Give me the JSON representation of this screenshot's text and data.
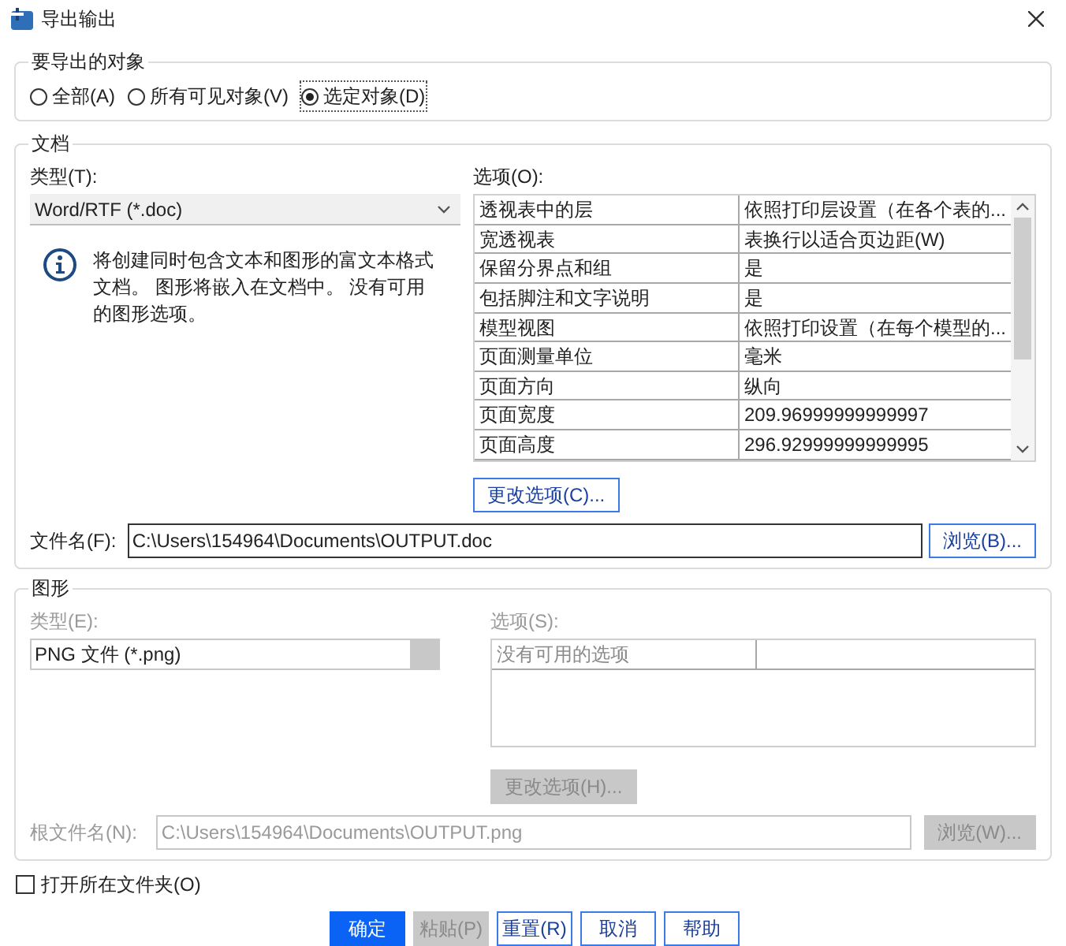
{
  "window": {
    "title": "导出输出"
  },
  "export_objects": {
    "title": "要导出的对象",
    "options": [
      {
        "label": "全部(A)",
        "selected": false
      },
      {
        "label": "所有可见对象(V)",
        "selected": false
      },
      {
        "label": "选定对象(D)",
        "selected": true
      }
    ]
  },
  "document": {
    "title": "文档",
    "type_label": "类型(T):",
    "type_value": "Word/RTF (*.doc)",
    "info": "将创建同时包含文本和图形的富文本格式文档。 图形将嵌入在文档中。 没有可用的图形选项。",
    "options_label": "选项(O):",
    "options": [
      [
        "透视表中的层",
        "依照打印层设置（在各个表的..."
      ],
      [
        "宽透视表",
        "表换行以适合页边距(W)"
      ],
      [
        "保留分界点和组",
        "是"
      ],
      [
        "包括脚注和文字说明",
        "是"
      ],
      [
        "模型视图",
        "依照打印设置（在每个模型的..."
      ],
      [
        "页面测量单位",
        "毫米"
      ],
      [
        "页面方向",
        "纵向"
      ],
      [
        "页面宽度",
        "209.96999999999997"
      ],
      [
        "页面高度",
        "296.92999999999995"
      ]
    ],
    "change_button": "更改选项(C)...",
    "file_label": "文件名(F):",
    "file_value": "C:\\Users\\154964\\Documents\\OUTPUT.doc",
    "browse_button": "浏览(B)..."
  },
  "graphics": {
    "title": "图形",
    "disabled": true,
    "type_label": "类型(E):",
    "type_value": "PNG 文件 (*.png)",
    "options_label": "选项(S):",
    "options": [
      [
        "没有可用的选项"
      ]
    ],
    "change_button": "更改选项(H)...",
    "file_label": "根文件名(N):",
    "file_value": "C:\\Users\\154964\\Documents\\OUTPUT.png",
    "browse_button": "浏览(W)..."
  },
  "open_folder": {
    "label": "打开所在文件夹(O)",
    "checked": false
  },
  "buttons": [
    {
      "label": "确定",
      "kind": "primary",
      "disabled": false
    },
    {
      "label": "粘贴(P)",
      "kind": "normal",
      "disabled": true
    },
    {
      "label": "重置(R)",
      "kind": "normal",
      "disabled": false
    },
    {
      "label": "取消",
      "kind": "normal",
      "disabled": false
    },
    {
      "label": "帮助",
      "kind": "normal",
      "disabled": false
    }
  ]
}
